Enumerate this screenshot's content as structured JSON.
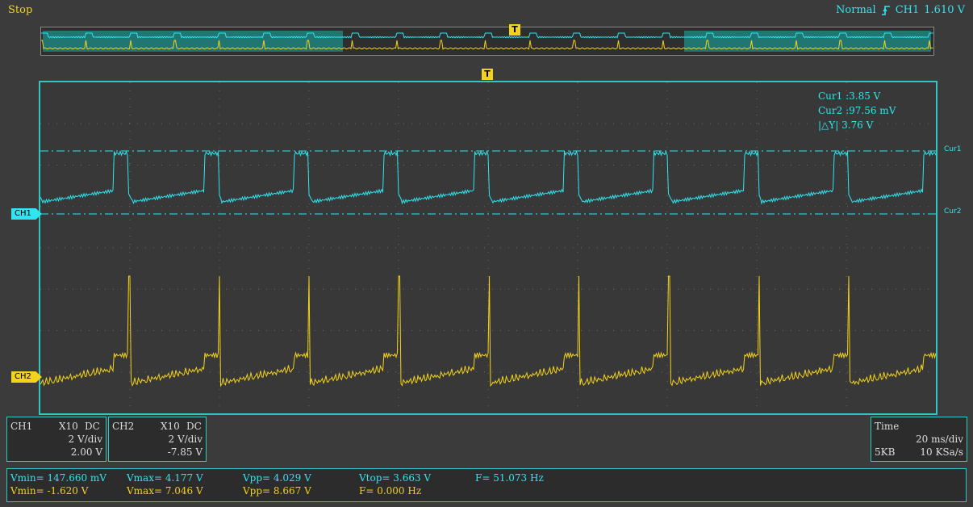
{
  "status": {
    "run_state": "Stop",
    "trigger_mode": "Normal",
    "trigger_source": "CH1",
    "trigger_level": "1.610 V",
    "trigger_edge_icon": "rising-edge-icon"
  },
  "markers": {
    "trigger": "T"
  },
  "channels": {
    "ch1": {
      "tag": "CH1",
      "color": "#2ee6f2"
    },
    "ch2": {
      "tag": "CH2",
      "color": "#f2d21a"
    }
  },
  "cursors": {
    "cur1_label": "Cur1",
    "cur1_value": "3.85 V",
    "cur2_label": "Cur2",
    "cur2_value": "97.56 mV",
    "delta_label": "|△Y|",
    "delta_value": "3.76 V"
  },
  "ch1_panel": {
    "name": "CH1",
    "probe": "X10",
    "coupling": "DC",
    "scale": "2 V/div",
    "offset": "2.00 V"
  },
  "ch2_panel": {
    "name": "CH2",
    "probe": "X10",
    "coupling": "DC",
    "scale": "2 V/div",
    "offset": "-7.85 V"
  },
  "time_panel": {
    "title": "Time",
    "scale": "20 ms/div",
    "memory": "5KB",
    "sample_rate": "10 KSa/s"
  },
  "measurements": {
    "ch1": {
      "vmin": "Vmin= 147.660 mV",
      "vmax": "Vmax= 4.177 V",
      "vpp": "Vpp= 4.029 V",
      "vtop": "Vtop= 3.663 V",
      "freq": "F= 51.073 Hz"
    },
    "ch2": {
      "vmin": "Vmin= -1.620 V",
      "vmax": "Vmax= 7.046 V",
      "vpp": "Vpp= 8.667 V",
      "freq": "F= 0.000 Hz"
    }
  },
  "chart_data": {
    "type": "line",
    "x_scale": "20 ms/div",
    "divisions_x": 10,
    "series": [
      {
        "name": "CH1",
        "description": "square-like wave, period ~19.6 ms, high ~3.85 V, low ~0.8 V with ramp",
        "frequency_hz": 51.073,
        "vmin": 0.14766,
        "vmax": 4.177
      },
      {
        "name": "CH2",
        "description": "low-level pulses with spikes at each CH1 edge",
        "vmin": -1.62,
        "vmax": 7.046
      }
    ]
  }
}
